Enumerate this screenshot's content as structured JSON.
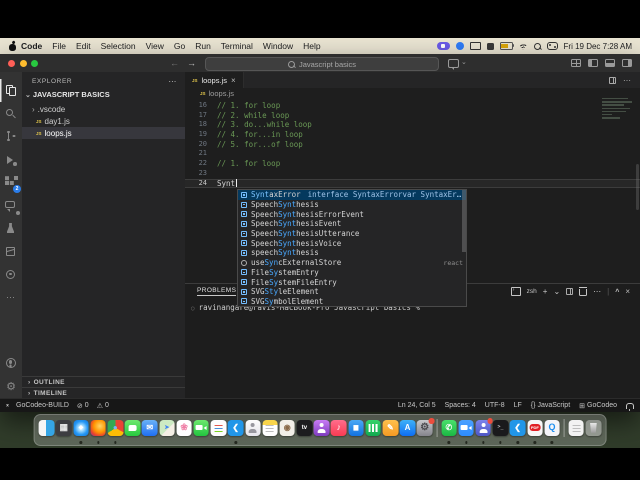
{
  "menu_bar": {
    "items": [
      {
        "label": "Code",
        "cls": "bold"
      },
      {
        "label": "File"
      },
      {
        "label": "Edit"
      },
      {
        "label": "Selection"
      },
      {
        "label": "View"
      },
      {
        "label": "Go"
      },
      {
        "label": "Run"
      },
      {
        "label": "Terminal"
      },
      {
        "label": "Window"
      },
      {
        "label": "Help"
      }
    ],
    "clock": "Fri 19 Dec 7:28 AM"
  },
  "window": {
    "title_bar": {
      "search_text": "Javascript basics"
    },
    "tab": {
      "label": "loops.js"
    },
    "activity_bar": {
      "extensions_badge": "2"
    },
    "explorer": {
      "header": "EXPLORER",
      "project": "JAVASCRIPT BASICS",
      "files": [
        {
          "arrow": "›",
          "name": ".vscode",
          "cls": "folder"
        },
        {
          "js": true,
          "name": "day1.js",
          "cls": "file"
        },
        {
          "js": true,
          "name": "loops.js",
          "cls": "file selected"
        }
      ],
      "outline_label": "OUTLINE",
      "timeline_label": "TIMELINE"
    },
    "editor": {
      "breadcrumb": "loops.js",
      "code_lines": [
        {
          "num": "16",
          "text": "// 1. for loop",
          "cls": "comment"
        },
        {
          "num": "17",
          "text": "// 2. while loop",
          "cls": "comment"
        },
        {
          "num": "18",
          "text": "// 3. do...while loop",
          "cls": "comment"
        },
        {
          "num": "19",
          "text": "// 4. for...in loop",
          "cls": "comment"
        },
        {
          "num": "20",
          "text": "// 5. for...of loop",
          "cls": "comment"
        },
        {
          "num": "21",
          "text": "",
          "cls": "plain"
        },
        {
          "num": "22",
          "text": "// 1. for loop",
          "cls": "comment"
        },
        {
          "num": "23",
          "text": "",
          "cls": "plain"
        },
        {
          "num": "24",
          "text": "Synt",
          "cls": "plain active",
          "cursor": true
        }
      ]
    },
    "suggest": {
      "rows": [
        {
          "pre": "",
          "match": "Synt",
          "post": "axError",
          "kind": "k-int",
          "cls": "selected",
          "detail": "interface SyntaxErrorvar SyntaxError: Syntax…"
        },
        {
          "pre": "Speech",
          "match": "Synt",
          "post": "hesis",
          "kind": "k-int"
        },
        {
          "pre": "Speech",
          "match": "Synt",
          "post": "hesisErrorEvent",
          "kind": "k-int"
        },
        {
          "pre": "Speech",
          "match": "Synt",
          "post": "hesisEvent",
          "kind": "k-int"
        },
        {
          "pre": "Speech",
          "match": "Synt",
          "post": "hesisUtterance",
          "kind": "k-int"
        },
        {
          "pre": "Speech",
          "match": "Synt",
          "post": "hesisVoice",
          "kind": "k-int"
        },
        {
          "pre": "speech",
          "match": "Synt",
          "post": "hesis",
          "kind": "k-int"
        },
        {
          "pre": "use",
          "match": "Syn",
          "post": "cExternalStore",
          "kind": "k-mod",
          "right": "react"
        },
        {
          "pre": "File",
          "match": "Sy",
          "post": "stemEntry",
          "kind": "k-int"
        },
        {
          "pre": "File",
          "match": "Sy",
          "post": "stemFileEntry",
          "kind": "k-int"
        },
        {
          "pre": "SVG",
          "match": "Sty",
          "post": "leElement",
          "kind": "k-int"
        },
        {
          "pre": "SVG",
          "match": "Sy",
          "post": "mbolElement",
          "kind": "k-int"
        }
      ]
    },
    "panel": {
      "tab": "PROBLEMS",
      "shell": "zsh",
      "terminal_prompt": "ravinangare@ravis-MacBook-Pro Javascript basics %"
    },
    "status_bar": {
      "left": [
        {
          "label": "GoCodeo-BUILD"
        },
        {
          "icon": "⊘",
          "label": "0"
        },
        {
          "icon": "⚠",
          "label": "0"
        }
      ],
      "right": [
        {
          "label": "Ln 24, Col 5"
        },
        {
          "label": "Spaces: 4"
        },
        {
          "label": "UTF-8"
        },
        {
          "label": "LF"
        },
        {
          "icon": "{}",
          "label": "JavaScript"
        },
        {
          "icon": "⊞",
          "label": "GoCodeo"
        }
      ]
    }
  },
  "dock": {
    "items": [
      {
        "name": "finder",
        "bg": "linear-gradient(90deg,#f5f5f5 0 45%,#35a5e5 45% 100%)"
      },
      {
        "name": "launchpad",
        "bg": "#3d3d41",
        "glyph": "▦",
        "gc": "#e8e8e8",
        "gs": "9px"
      },
      {
        "name": "safari",
        "bg": "radial-gradient(circle,#bfe9ff 18%,#2598f5 60%,#1272d4)",
        "glyph": "◆",
        "gc": "#ffffff",
        "gs": "6px",
        "running": true
      },
      {
        "name": "firefox",
        "bg": "radial-gradient(circle at 62% 38%,#ffd567,#ff9500 45%,#e8452c 72%,#8c2ba0)",
        "running": true
      },
      {
        "name": "chrome",
        "bg": "conic-gradient(#ea4335 0 33%,#fbbc05 0 66%,#34a853 0 100%)",
        "glyph": "●",
        "gc": "#7db3f7",
        "gs": "8px",
        "running": true
      },
      {
        "name": "messages",
        "bg": "linear-gradient(#6ee86e,#27c93f)",
        "icls": "g-bubble"
      },
      {
        "name": "mail",
        "bg": "linear-gradient(#6ab1f7,#1f6ff2)",
        "glyph": "✉",
        "gc": "#ffffff",
        "gs": "8px"
      },
      {
        "name": "maps",
        "bg": "linear-gradient(135deg,#cdebc3 0 55%,#f4efe4 55%)",
        "glyph": "➤",
        "gc": "#4285f4",
        "gs": "6px"
      },
      {
        "name": "photos",
        "bg": "#ffffff",
        "glyph": "❀",
        "gc": "#ef7fa6",
        "gs": "9px"
      },
      {
        "name": "facetime",
        "bg": "linear-gradient(#6ee86e,#22c53e)",
        "icls": "g-cam"
      },
      {
        "name": "reminders",
        "bg": "#fdfdfd",
        "icls": "g-lines"
      },
      {
        "name": "vscode",
        "bg": "#2196e8",
        "glyph": "❮",
        "gc": "#ffffff",
        "gs": "8px",
        "running": true
      },
      {
        "name": "contacts",
        "bg": "linear-gradient(#fdfdfd,#e4e4ea)",
        "icls": "g-person",
        "gc": "#97979e"
      },
      {
        "name": "notes",
        "bg": "linear-gradient(#f9d54a 0 30%,#ffffff 30%)",
        "icls": "g-lines gray"
      },
      {
        "name": "globe-app",
        "bg": "#f2efe8",
        "glyph": "◉",
        "gc": "#8a6a4a",
        "gs": "8px"
      },
      {
        "name": "apple-tv",
        "bg": "#1c1c1e",
        "glyph": "tv",
        "gc": "#ffffff",
        "gs": "6px"
      },
      {
        "name": "podcasts",
        "bg": "linear-gradient(#c87bf5,#7d3bbd)",
        "icls": "g-person",
        "gc": "#ffffff"
      },
      {
        "name": "music",
        "bg": "linear-gradient(#ff6d8c,#f93b52)",
        "glyph": "♪",
        "gc": "#ffffff",
        "gs": "9px"
      },
      {
        "name": "keynote",
        "bg": "linear-gradient(#4aa8f5,#1272e0)",
        "glyph": "▆",
        "gc": "#ffffff",
        "gs": "6px"
      },
      {
        "name": "numbers",
        "bg": "linear-gradient(#35d36b,#12a94f)",
        "icls": "g-bars"
      },
      {
        "name": "pages",
        "bg": "linear-gradient(#ffc04d,#f59a23)",
        "glyph": "✎",
        "gc": "#ffffff",
        "gs": "8px"
      },
      {
        "name": "app-store",
        "bg": "linear-gradient(#3db1f8,#0d6ef2)",
        "glyph": "A",
        "gc": "#ffffff",
        "gs": "8px",
        "icls": "boldg"
      },
      {
        "name": "system-settings",
        "bg": "linear-gradient(#c8c8cc,#85858c)",
        "glyph": "⚙",
        "gc": "#4a4a4e",
        "gs": "10px",
        "badge": true
      },
      {
        "name": "whatsapp",
        "bg": "linear-gradient(#49e06c,#1bb843)",
        "glyph": "✆",
        "gc": "#ffffff",
        "gs": "8px",
        "rootcls": "sep",
        "running": true
      },
      {
        "name": "zoom",
        "bg": "linear-gradient(#4aa0ff,#2d8cff)",
        "icls": "g-cam",
        "running": true
      },
      {
        "name": "teams",
        "bg": "linear-gradient(#7b83eb,#4e56c4)",
        "icls": "g-person",
        "gc": "#ffffff",
        "badge": true,
        "running": true
      },
      {
        "name": "terminal",
        "bg": "#1a1a1c",
        "glyph": ">_",
        "gc": "#f0f0f0",
        "gs": "5px",
        "icls": "monog",
        "running": true
      },
      {
        "name": "vscode-2",
        "bg": "#2196e8",
        "glyph": "❮",
        "gc": "#ffffff",
        "gs": "8px",
        "running": true
      },
      {
        "name": "pdf-app",
        "bg": "#f6f6f6",
        "glyph": "PDF",
        "gc": "#ffffff",
        "gs": "4px",
        "icls": "g-chip",
        "running": true
      },
      {
        "name": "quicktime",
        "bg": "#f4f4f8",
        "glyph": "Q",
        "gc": "#1d8ef0",
        "gs": "9px",
        "icls": "boldg",
        "running": true
      },
      {
        "name": "documents",
        "bg": "#f2f2f2",
        "icls": "g-lines gray",
        "rootcls": "sep"
      },
      {
        "name": "trash",
        "bg": "rgba(255,255,255,0.35)",
        "icls": "g-trash"
      }
    ]
  }
}
